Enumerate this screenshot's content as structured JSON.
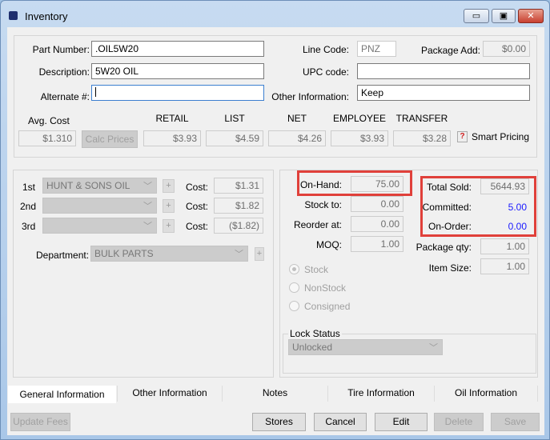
{
  "window": {
    "title": "Inventory",
    "icon": "cube-icon",
    "controls": {
      "minimize": "▭",
      "maximize": "▣",
      "close": "✕"
    }
  },
  "header": {
    "part_number": {
      "label": "Part Number:",
      "value": ".OIL5W20"
    },
    "description": {
      "label": "Description:",
      "value": "5W20 OIL"
    },
    "alternate": {
      "label": "Alternate #:",
      "value": ""
    },
    "line_code": {
      "label": "Line Code:",
      "value": "PNZ"
    },
    "package_add": {
      "label": "Package Add:",
      "value": "$0.00"
    },
    "upc": {
      "label": "UPC code:",
      "value": ""
    },
    "other_info": {
      "label": "Other Information:",
      "value": "Keep"
    }
  },
  "pricing": {
    "avg_cost_label": "Avg. Cost",
    "avg_cost": "$1.310",
    "calc_prices": "Calc Prices",
    "columns": [
      {
        "label": "RETAIL",
        "value": "$3.93"
      },
      {
        "label": "LIST",
        "value": "$4.59"
      },
      {
        "label": "NET",
        "value": "$4.26"
      },
      {
        "label": "EMPLOYEE",
        "value": "$3.93"
      },
      {
        "label": "TRANSFER",
        "value": "$3.28"
      }
    ],
    "help_icon": "?",
    "smart_pricing": "Smart Pricing"
  },
  "vendors": [
    {
      "label": "1st",
      "vendor": "HUNT & SONS OIL",
      "cost_label": "Cost:",
      "cost": "$1.31"
    },
    {
      "label": "2nd",
      "vendor": "",
      "cost_label": "Cost:",
      "cost": "$1.82"
    },
    {
      "label": "3rd",
      "vendor": "",
      "cost_label": "Cost:",
      "cost": "($1.82)"
    }
  ],
  "department": {
    "label": "Department:",
    "value": "BULK PARTS"
  },
  "plus": "+",
  "chevron": "﹀",
  "stock": {
    "on_hand": {
      "label": "On-Hand:",
      "value": "75.00"
    },
    "stock_to": {
      "label": "Stock to:",
      "value": "0.00"
    },
    "reorder_at": {
      "label": "Reorder at:",
      "value": "0.00"
    },
    "moq": {
      "label": "MOQ:",
      "value": "1.00"
    },
    "total_sold": {
      "label": "Total Sold:",
      "value": "5644.93"
    },
    "committed": {
      "label": "Committed:",
      "value": "5.00"
    },
    "on_order": {
      "label": "On-Order:",
      "value": "0.00"
    },
    "package_qty": {
      "label": "Package qty:",
      "value": "1.00"
    },
    "item_size": {
      "label": "Item Size:",
      "value": "1.00"
    },
    "radios": [
      "Stock",
      "NonStock",
      "Consigned"
    ],
    "lock_status": {
      "label": "Lock Status",
      "value": "Unlocked"
    }
  },
  "tabs": [
    "General Information",
    "Other Information",
    "Notes",
    "Tire Information",
    "Oil Information"
  ],
  "buttons": {
    "update_fees": "Update Fees",
    "stores": "Stores",
    "cancel": "Cancel",
    "edit": "Edit",
    "delete": "Delete",
    "save": "Save"
  }
}
